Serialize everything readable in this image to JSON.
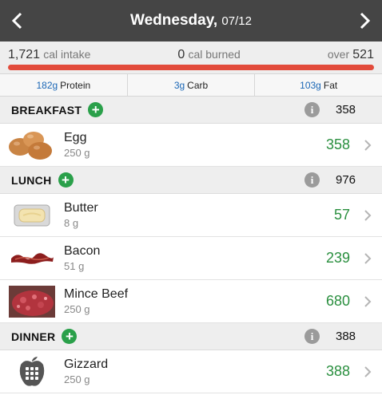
{
  "header": {
    "day": "Wednesday,",
    "date": "07/12"
  },
  "summary": {
    "intake_value": "1,721",
    "intake_label": "cal intake",
    "burned_value": "0",
    "burned_label": "cal burned",
    "over_label": "over",
    "over_value": "521",
    "bar_color": "#e24b3b"
  },
  "macros": [
    {
      "value": "182g",
      "label": "Protein"
    },
    {
      "value": "3g",
      "label": "Carb"
    },
    {
      "value": "103g",
      "label": "Fat"
    }
  ],
  "meals": [
    {
      "name": "BREAKFAST",
      "total": "358",
      "items": [
        {
          "name": "Egg",
          "amount": "250 g",
          "cal": "358",
          "icon": "egg-image"
        }
      ]
    },
    {
      "name": "LUNCH",
      "total": "976",
      "items": [
        {
          "name": "Butter",
          "amount": "8 g",
          "cal": "57",
          "icon": "butter-image"
        },
        {
          "name": "Bacon",
          "amount": "51 g",
          "cal": "239",
          "icon": "bacon-image"
        },
        {
          "name": "Mince Beef",
          "amount": "250 g",
          "cal": "680",
          "icon": "mince-beef-image"
        }
      ]
    },
    {
      "name": "DINNER",
      "total": "388",
      "items": [
        {
          "name": "Gizzard",
          "amount": "250 g",
          "cal": "388",
          "icon": "calculator-apple-icon"
        }
      ]
    }
  ],
  "colors": {
    "header_bg": "#454545",
    "accent_green": "#2aa04a",
    "calorie_green": "#2a8f3f",
    "macro_blue": "#1a66b5"
  }
}
